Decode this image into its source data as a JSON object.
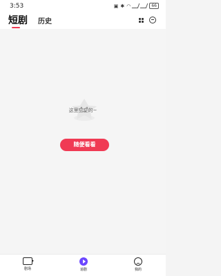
{
  "status": {
    "time": "3:53",
    "battery_label": "66"
  },
  "topbar": {
    "tab_shortplay": "短剧",
    "tab_history": "历史",
    "active_tab": "短剧"
  },
  "empty_state": {
    "message": "这里空空的~",
    "button_label": "随便看看"
  },
  "bottom_nav": {
    "items": [
      {
        "label": "剧场",
        "icon": "video-icon"
      },
      {
        "label": "追剧",
        "icon": "play-circle-icon"
      },
      {
        "label": "我的",
        "icon": "profile-icon"
      }
    ]
  },
  "colors": {
    "accent": "#f03a54",
    "nav_active": "#6b46ff"
  }
}
